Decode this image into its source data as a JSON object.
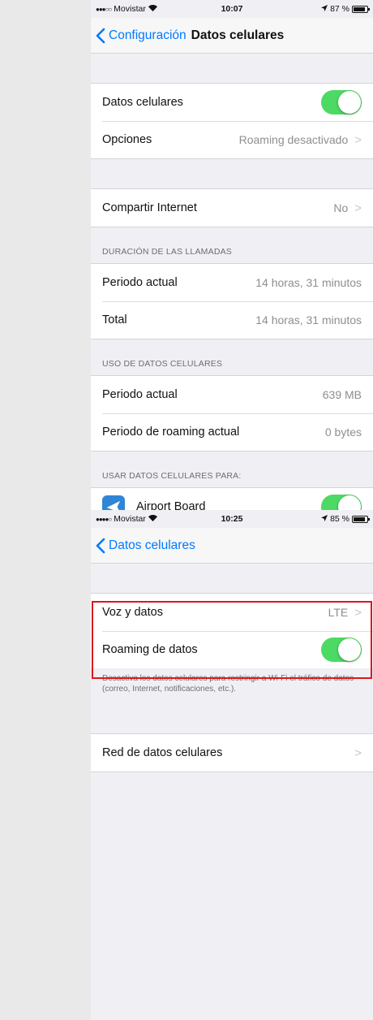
{
  "screen1": {
    "status": {
      "carrier": "Movistar",
      "time": "10:07",
      "battery": "87 %",
      "battery_level": 0.87
    },
    "nav": {
      "back_label": "Configuración",
      "title": "Datos celulares"
    },
    "group1": {
      "cellular_data_label": "Datos celulares",
      "cellular_data_on": true,
      "options_label": "Opciones",
      "options_value": "Roaming desactivado"
    },
    "hotspot": {
      "label": "Compartir Internet",
      "value": "No"
    },
    "call_duration": {
      "header": "DURACIÓN DE LAS LLAMADAS",
      "rows": [
        {
          "label": "Periodo actual",
          "value": "14 horas, 31 minutos"
        },
        {
          "label": "Total",
          "value": "14 horas, 31 minutos"
        }
      ]
    },
    "data_usage": {
      "header": "USO DE DATOS CELULARES",
      "rows": [
        {
          "label": "Periodo actual",
          "value": "639 MB"
        },
        {
          "label": "Periodo de roaming actual",
          "value": "0 bytes"
        }
      ]
    },
    "apps": {
      "header": "USAR DATOS CELULARES PARA:",
      "items": [
        {
          "label": "Airport Board",
          "icon": "airplane-icon",
          "on": true
        }
      ]
    }
  },
  "screen2": {
    "status": {
      "carrier": "Movistar",
      "time": "10:25",
      "battery": "85 %",
      "battery_level": 0.85
    },
    "nav": {
      "back_label": "Datos celulares"
    },
    "voice": {
      "label": "Voz y datos",
      "value": "LTE"
    },
    "roaming": {
      "label": "Roaming de datos",
      "on": true,
      "note": "Desactiva los datos celulares para restringir a Wi-Fi el tráfico de datos (correo, Internet, notificaciones, etc.)."
    },
    "network": {
      "label": "Red de datos celulares"
    }
  },
  "colors": {
    "accent": "#007aff",
    "toggle_on": "#4cd964",
    "highlight": "#e0161d",
    "background": "#efeff4"
  }
}
